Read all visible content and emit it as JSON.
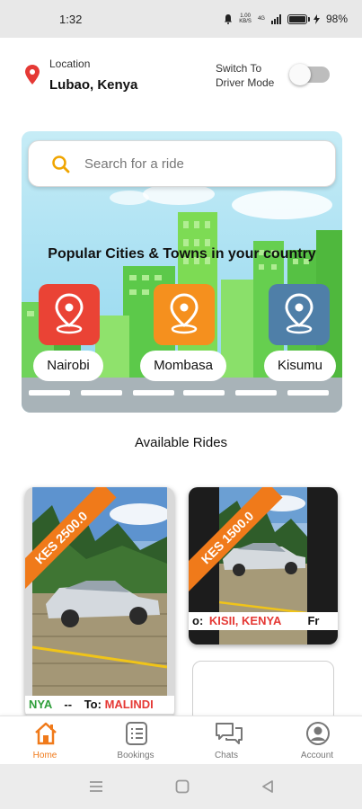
{
  "status_bar": {
    "time": "1:32",
    "network_speed_top": "1.00",
    "network_speed_bottom": "KB/S",
    "network_type": "4G",
    "battery": "98%"
  },
  "header": {
    "location_label": "Location",
    "location_value": "Lubao, Kenya",
    "switch_label": "Switch To Driver Mode",
    "driver_mode_on": false
  },
  "search": {
    "placeholder": "Search for a ride"
  },
  "hero": {
    "title": "Popular Cities & Towns in your country",
    "cities": [
      {
        "name": "Nairobi",
        "color": "#ea4335"
      },
      {
        "name": "Mombasa",
        "color": "#f5901e"
      },
      {
        "name": "Kisumu",
        "color": "#4f7fa8"
      }
    ]
  },
  "rides_section": {
    "title": "Available Rides"
  },
  "rides": [
    {
      "price": "KES 2500.0",
      "from_fragment": "NYA",
      "separator": "--",
      "to_prefix": "To:",
      "to_value": "MALINDI"
    },
    {
      "price": "KES 1500.0",
      "to_prefix": "o:",
      "to_value": "KISII, KENYA",
      "next_fragment": "Fr"
    }
  ],
  "bottom_nav": {
    "items": [
      {
        "label": "Home",
        "icon": "home-icon",
        "active": true
      },
      {
        "label": "Bookings",
        "icon": "bookings-icon",
        "active": false
      },
      {
        "label": "Chats",
        "icon": "chats-icon",
        "active": false
      },
      {
        "label": "Account",
        "icon": "account-icon",
        "active": false
      }
    ]
  },
  "colors": {
    "accent": "#f07a1a",
    "pin": "#e53935"
  }
}
